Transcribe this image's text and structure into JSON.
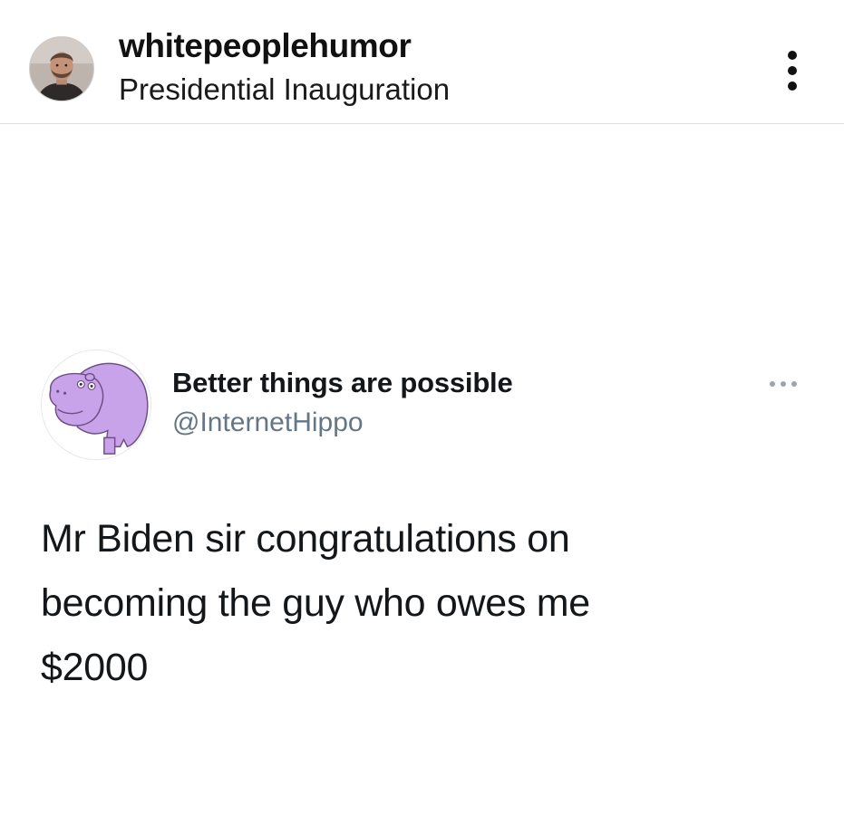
{
  "post": {
    "username": "whitepeoplehumor",
    "location": "Presidential Inauguration",
    "avatar_icon": "user-photo-avatar",
    "options_icon": "more-vertical-icon"
  },
  "tweet": {
    "display_name": "Better things are possible",
    "handle": "@InternetHippo",
    "avatar_icon": "purple-hippo-avatar",
    "options_icon": "more-horizontal-icon",
    "text_lines": [
      "Mr Biden sir congratulations on",
      "becoming the guy who owes me",
      "$2000"
    ],
    "hippo_color": "#c9a3ea"
  },
  "colors": {
    "text_primary": "#14171a",
    "text_secondary": "#657786",
    "divider": "#dedede"
  }
}
